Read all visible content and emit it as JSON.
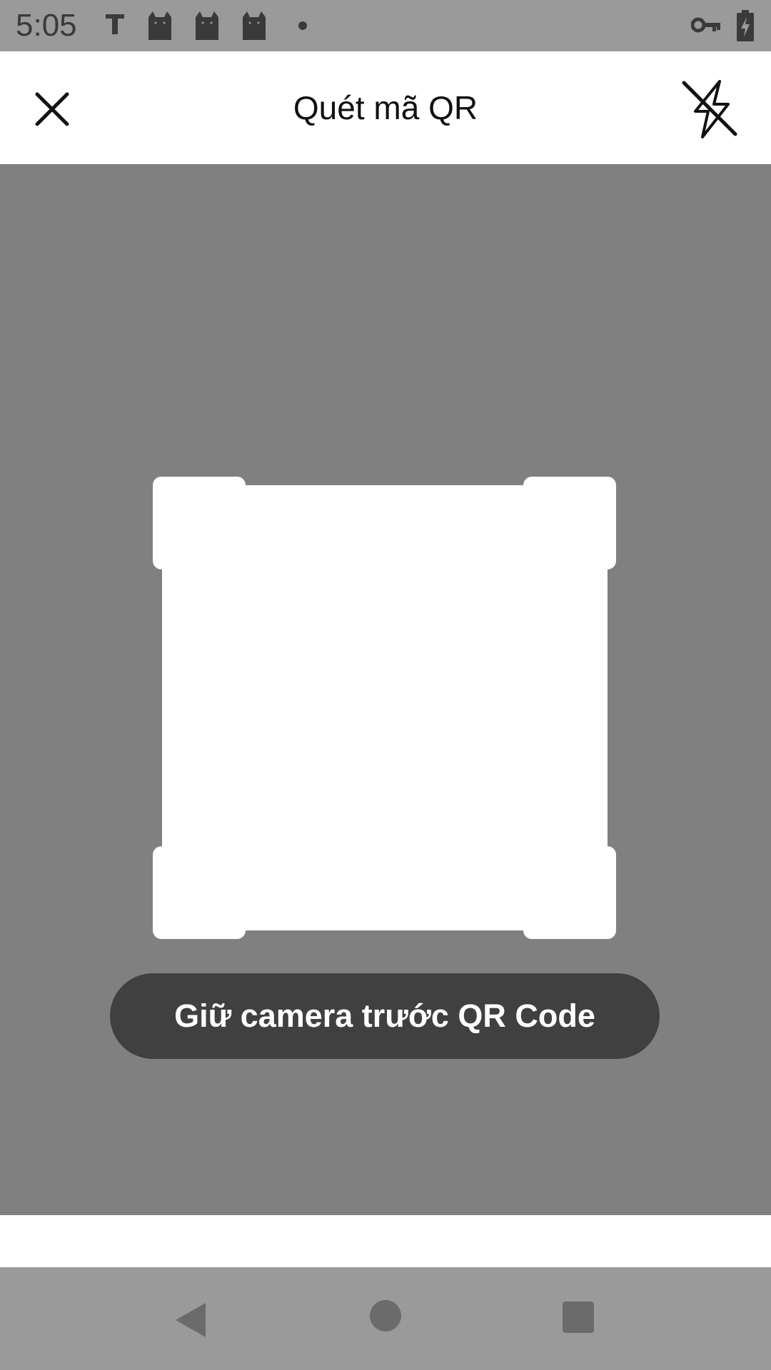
{
  "status_bar": {
    "time": "5:05",
    "icons": [
      "t-icon",
      "cat-icon",
      "cat-icon",
      "cat-icon",
      "dot-icon",
      "vpn-key-icon",
      "battery-charging-icon"
    ]
  },
  "header": {
    "title": "Quét mã QR",
    "close_icon": "close-icon",
    "flash_icon": "flash-off-icon"
  },
  "scanner": {
    "hint": "Giữ camera trước QR Code"
  },
  "nav": {
    "back_icon": "back-icon",
    "home_icon": "home-icon",
    "recents_icon": "recents-icon"
  },
  "colors": {
    "camera_bg": "#808080",
    "status_bar_bg": "#9a9a9a",
    "pill_bg": "#404040",
    "surface": "#ffffff"
  }
}
